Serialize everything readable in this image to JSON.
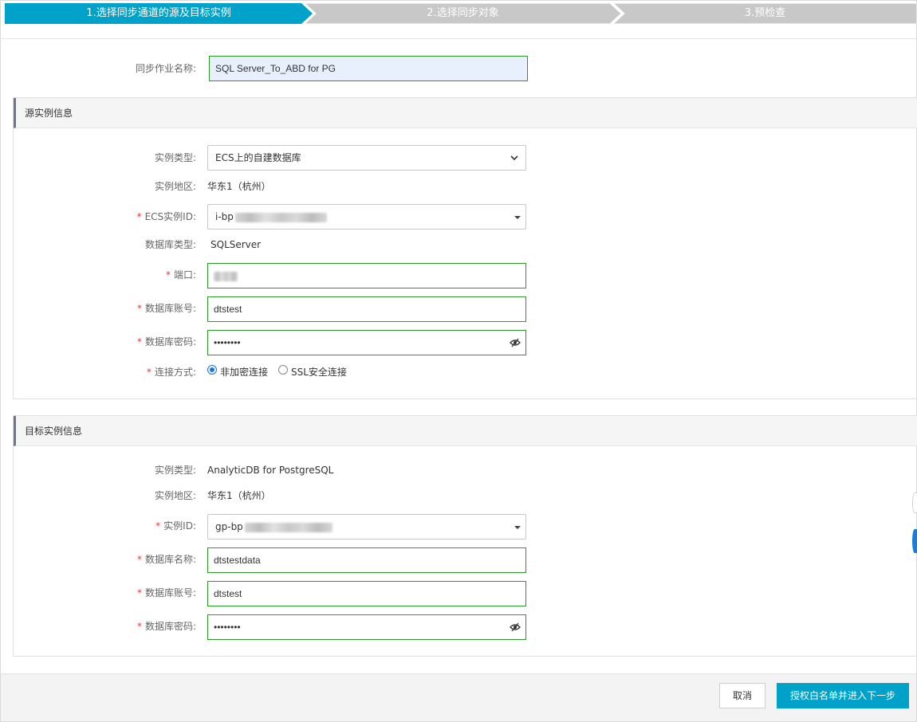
{
  "steps": [
    {
      "label": "1.选择同步通道的源及目标实例",
      "active": true
    },
    {
      "label": "2.选择同步对象",
      "active": false
    },
    {
      "label": "3.预检查",
      "active": false
    }
  ],
  "job": {
    "label": "同步作业名称:",
    "value": "SQL Server_To_ABD for PG"
  },
  "source": {
    "title": "源实例信息",
    "instance_type_label": "实例类型:",
    "instance_type_value": "ECS上的自建数据库",
    "region_label": "实例地区:",
    "region_value": "华东1（杭州）",
    "ecs_id_label": "ECS实例ID:",
    "ecs_id_prefix": "i-bp",
    "db_type_label": "数据库类型:",
    "db_type_value": "SQLServer",
    "port_label": "端口:",
    "account_label": "数据库账号:",
    "account_value": "dtstest",
    "password_label": "数据库密码:",
    "password_value": "••••••••",
    "conn_label": "连接方式:",
    "conn_options": [
      "非加密连接",
      "SSL安全连接"
    ],
    "conn_selected": "非加密连接"
  },
  "target": {
    "title": "目标实例信息",
    "instance_type_label": "实例类型:",
    "instance_type_value": "AnalyticDB for PostgreSQL",
    "region_label": "实例地区:",
    "region_value": "华东1（杭州）",
    "instance_id_label": "实例ID:",
    "instance_id_prefix": "gp-bp",
    "db_name_label": "数据库名称:",
    "db_name_value": "dtstestdata",
    "account_label": "数据库账号:",
    "account_value": "dtstest",
    "password_label": "数据库密码:",
    "password_value": "••••••••"
  },
  "footer": {
    "cancel_label": "取消",
    "next_label": "授权白名单并进入下一步"
  },
  "colors": {
    "step_active": "#00a2ca",
    "step_inactive": "#c8c8c8",
    "input_border": "#2b9a2b",
    "primary_button": "#00a2ca",
    "required_star": "#e4393c"
  },
  "icons": {
    "password_toggle": "eye-slash-icon",
    "select_chevron": "chevron-down-icon",
    "dropdown_caret": "caret-down-icon"
  }
}
